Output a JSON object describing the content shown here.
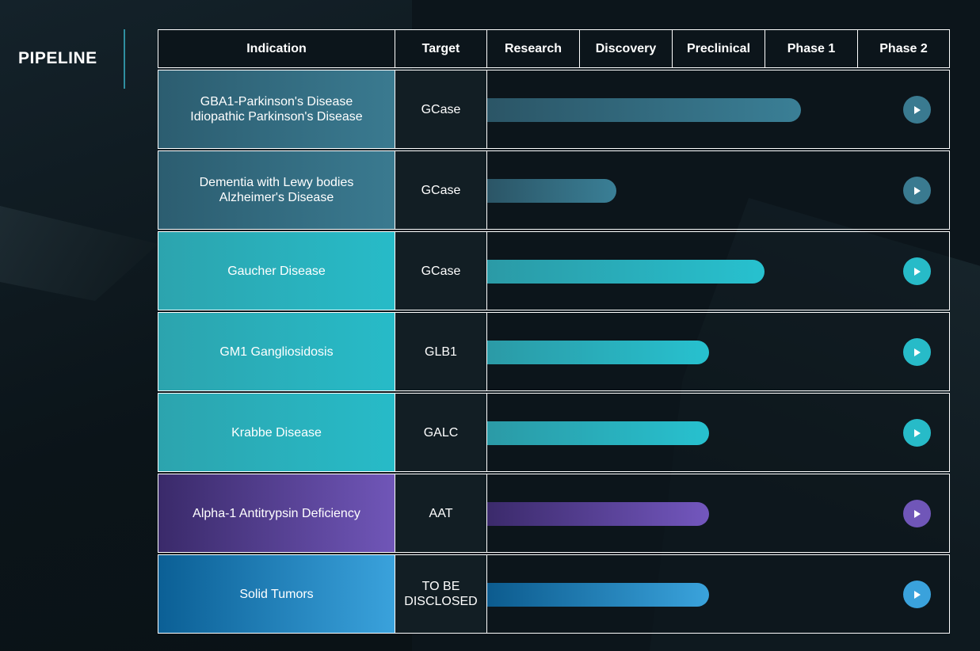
{
  "brand": {
    "title": "PIPELINE"
  },
  "columns": [
    "Indication",
    "Target",
    "Research",
    "Discovery",
    "Preclinical",
    "Phase 1",
    "Phase 2"
  ],
  "rows": [
    {
      "indication_line1": "GBA1-Parkinson's Disease",
      "indication_line2": "Idiopathic Parkinson's Disease",
      "target": "GCase",
      "progress": 0.68,
      "theme": "steel"
    },
    {
      "indication_line1": "Dementia with Lewy bodies",
      "indication_line2": "Alzheimer's Disease",
      "target": "GCase",
      "progress": 0.28,
      "theme": "steel"
    },
    {
      "indication_line1": "Gaucher Disease",
      "indication_line2": "",
      "target": "GCase",
      "progress": 0.6,
      "theme": "teal"
    },
    {
      "indication_line1": "GM1 Gangliosidosis",
      "indication_line2": "",
      "target": "GLB1",
      "progress": 0.48,
      "theme": "teal"
    },
    {
      "indication_line1": "Krabbe Disease",
      "indication_line2": "",
      "target": "GALC",
      "progress": 0.48,
      "theme": "teal"
    },
    {
      "indication_line1": "Alpha-1 Antitrypsin Deficiency",
      "indication_line2": "",
      "target": "AAT",
      "progress": 0.48,
      "theme": "purple"
    },
    {
      "indication_line1": "Solid Tumors",
      "indication_line2": "",
      "target": "TO BE\nDISCLOSED",
      "progress": 0.48,
      "theme": "blue"
    }
  ],
  "colors": {
    "steel": "#3a7a90",
    "teal": "#27bbc8",
    "purple": "#7056b8",
    "blue": "#3aa2dc",
    "background": "#0c151b"
  },
  "icons": {
    "row_action": "play-circle-icon"
  }
}
